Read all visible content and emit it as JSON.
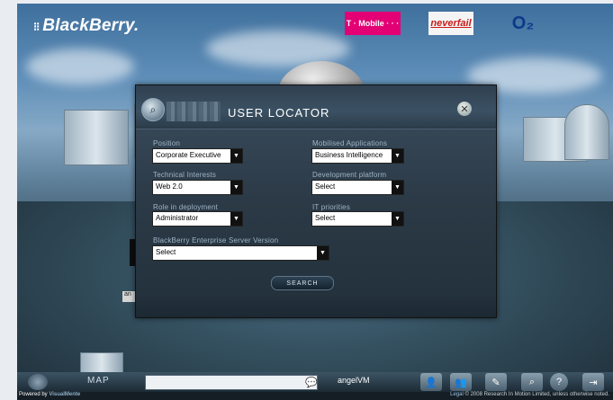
{
  "brand": {
    "logo_mark": "⁝⁝",
    "logo_text": "BlackBerry."
  },
  "sponsors": {
    "tmobile": "T · Mobile · · ·",
    "neverfail": "neverfail",
    "o2": "O₂"
  },
  "dialog": {
    "title": "USER LOCATOR",
    "close_glyph": "✕",
    "fields": {
      "position": {
        "label": "Position",
        "value": "Corporate Executive"
      },
      "mobilised_applications": {
        "label": "Mobilised Applications",
        "value": "Business Intelligence"
      },
      "technical_interests": {
        "label": "Technical Interests",
        "value": "Web 2.0"
      },
      "development_platform": {
        "label": "Development platform",
        "value": "Select"
      },
      "role_in_deployment": {
        "label": "Role in deployment",
        "value": "Administrator"
      },
      "it_priorities": {
        "label": "IT priorities",
        "value": "Select"
      },
      "bes_version": {
        "label": "BlackBerry Enterprise Server Version",
        "value": "Select"
      }
    },
    "search_label": "SEARCH"
  },
  "scene": {
    "ang_label": "an"
  },
  "toolbar": {
    "map_label": "MAP",
    "search_value": "",
    "username": "angelVM",
    "icons": [
      "user-icon",
      "group-icon",
      "tag-icon",
      "locate-icon",
      "help-icon",
      "exit-icon"
    ]
  },
  "footer": {
    "powered_prefix": "Powered by ",
    "powered_brand": "VisualMente",
    "legal_link": "Legal",
    "legal_text": " © 2008 Research In Motion Limited, unless otherwise noted."
  }
}
